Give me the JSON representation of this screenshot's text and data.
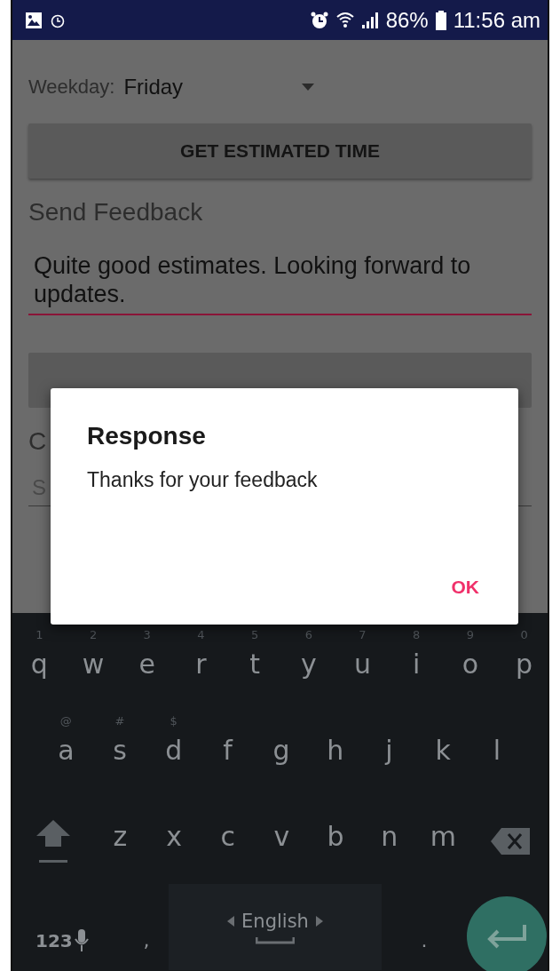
{
  "status_bar": {
    "battery": "86%",
    "time": "11:56 am"
  },
  "form": {
    "weekday_label": "Weekday:",
    "weekday_value": "Friday",
    "estimate_button": "GET ESTIMATED TIME",
    "feedback_heading": "Send Feedback",
    "feedback_value": "Quite good estimates. Looking forward to updates.",
    "feedback_focused": true,
    "label_2": "C",
    "field_2_placeholder": "S"
  },
  "dialog": {
    "title": "Response",
    "message": "Thanks for your feedback",
    "buttons": [
      "OK"
    ]
  },
  "keyboard": {
    "rows": [
      [
        {
          "key": "q",
          "hint": "1"
        },
        {
          "key": "w",
          "hint": "2"
        },
        {
          "key": "e",
          "hint": "3"
        },
        {
          "key": "r",
          "hint": "4"
        },
        {
          "key": "t",
          "hint": "5"
        },
        {
          "key": "y",
          "hint": "6"
        },
        {
          "key": "u",
          "hint": "7"
        },
        {
          "key": "i",
          "hint": "8"
        },
        {
          "key": "o",
          "hint": "9"
        },
        {
          "key": "p",
          "hint": "0"
        }
      ],
      [
        {
          "key": "a",
          "hint": "@"
        },
        {
          "key": "s",
          "hint": "#"
        },
        {
          "key": "d",
          "hint": "$"
        },
        {
          "key": "f"
        },
        {
          "key": "g"
        },
        {
          "key": "h"
        },
        {
          "key": "j"
        },
        {
          "key": "k"
        },
        {
          "key": "l"
        }
      ],
      [
        {
          "key": "z"
        },
        {
          "key": "x"
        },
        {
          "key": "c"
        },
        {
          "key": "v"
        },
        {
          "key": "b"
        },
        {
          "key": "n"
        },
        {
          "key": "m"
        }
      ]
    ],
    "numbers_key": "123",
    "comma": ",",
    "language": "English",
    "period": "."
  }
}
